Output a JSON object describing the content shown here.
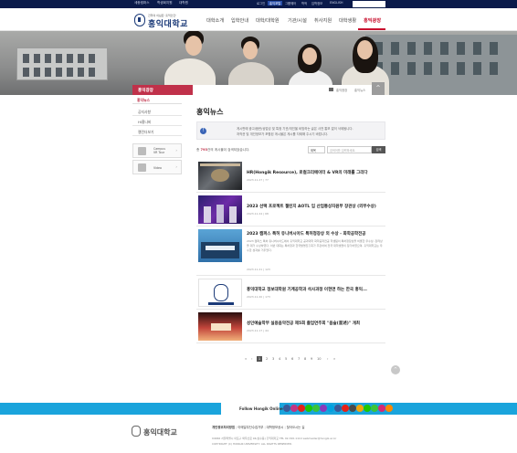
{
  "topbar": {
    "left_links": [
      "세종캠퍼스",
      "학생회지원",
      "대학원"
    ],
    "right_links": [
      "로그인",
      "홍익포털",
      "그룹웨어",
      "학적",
      "입학정보",
      "ENGLISH"
    ],
    "active_right": "홍익포털"
  },
  "logo": {
    "subtitle": "건학의 이념은 '홍익인간'",
    "name": "홍익대학교"
  },
  "gnb": {
    "items": [
      "대학소개",
      "입학안내",
      "대학/대학원",
      "기관/시설",
      "취사지원",
      "대학생활",
      "홍익광장"
    ],
    "active": "홍익광장"
  },
  "sub": {
    "section_title": "홍익광장",
    "breadcrumb": [
      "홍익광장",
      "홍익뉴스"
    ],
    "up_symbol": "^"
  },
  "lnb": {
    "active": "홍익뉴스",
    "items": [
      "공지사항",
      "HI홍나비",
      "캘린더보기"
    ]
  },
  "side_cards": [
    {
      "title": "Campus\nVR Tour",
      "icon": "vr-icon"
    },
    {
      "title": "Video",
      "icon": "video-icon"
    }
  ],
  "page_title": "홍익뉴스",
  "notice": {
    "line1": "게시판에 광고/음란/상업성 및 특정 기관/개인을 비방하는 글은 사전 통보 없이 삭제됩니다.",
    "line2": "저작권 및 개인정보가 포함된 게시물은 게시를 자제해 주시기 바랍니다."
  },
  "list": {
    "count_prefix": "총",
    "count": "793",
    "count_suffix": "건의 게시물이 검색되었습니다.",
    "search_select": "제목",
    "search_placeholder": "검색어를 입력하세요.",
    "search_button": "검색"
  },
  "posts": [
    {
      "title": "HR(Hongik Resource), 로컬크리에이터 & VR의 미래를 그리다",
      "date": "2023.11.27  |  77",
      "desc": ""
    },
    {
      "title": "2023 선택 프로젝트 챌린지 AOTL 입 산업통상자원부 장관상 (외부수상)",
      "date": "2023.11.24  |  68",
      "desc": ""
    },
    {
      "title": "2023 캠퍼스 특허 유니버시아드 특허청장상 외 수상 - 화학공학전공",
      "date": "2023.11.21  |  123",
      "desc": "2023 캠퍼스 특허 유니버시아드에서 홍익대학교 공과대학 화학공학전공 학생팀이 특허청장상을 비롯한 우수상, 장려상을 대거 수상하였다. 이번 대회는 특허청과 한국발명진흥회가 주관하여 전국 대학생들이 참가하였으며, 홍익대학교는 우수한 성과를 거두었다."
    },
    {
      "title": "홍익대학교 정보대학원 기계공학과 석사과정 이현면 하는 한국 홍익...",
      "date": "2023.11.20  |  173",
      "desc": ""
    },
    {
      "title": "성인예술학부 실용음악전공 제5회 졸업연주회 \"음술(音述)\" 개최",
      "date": "2023.11.17  |  44",
      "desc": ""
    }
  ],
  "pagination": {
    "prev": [
      "«",
      "‹"
    ],
    "pages": [
      "1",
      "2",
      "3",
      "4",
      "5",
      "6",
      "7",
      "8",
      "9",
      "10"
    ],
    "current": "1",
    "next": [
      "›",
      "»"
    ]
  },
  "sns": {
    "label": "Follow Hongik Online",
    "colors": [
      "#3b5998",
      "#c13584",
      "#e62117",
      "#1ec800",
      "#3ac43a",
      "#8a3ab9",
      "#00a1e0",
      "#3b5998",
      "#e62117",
      "#4a4a4a",
      "#f2a50a",
      "#1ec800",
      "#3ac43a",
      "#d62976",
      "#ff8800"
    ]
  },
  "footer": {
    "logo": "홍익대학교",
    "links": [
      "개인정보처리방침",
      "이메일무단수집거부",
      "대학정보공시",
      "찾아오시는 길"
    ],
    "address": "04066 서울특별시 마포구 와우산로 94(상수동) 홍익대학교  TEL 02-320-1114  webmaster@hongik.ac.kr",
    "copyright": "COPYRIGHT (C) HONGIK UNIVERSITY. ALL RIGHTS RESERVED."
  }
}
